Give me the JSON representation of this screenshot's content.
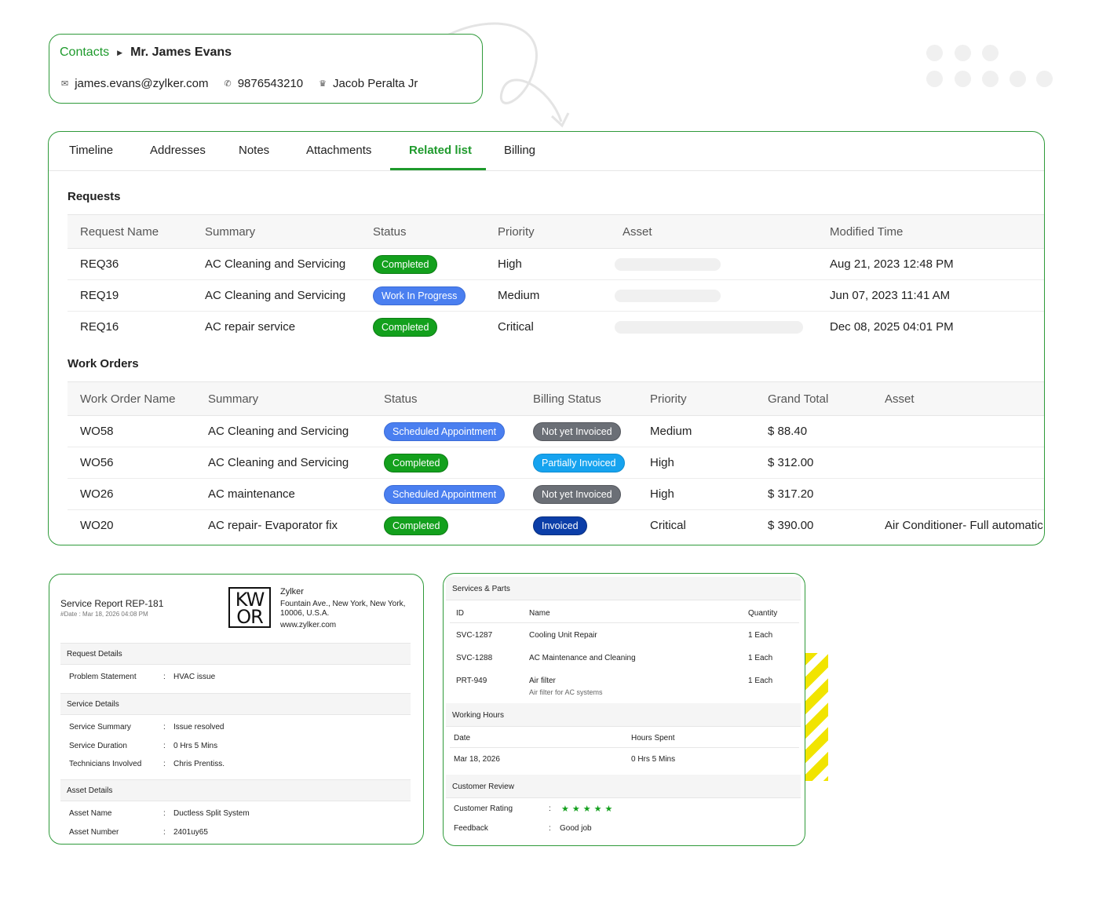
{
  "header": {
    "breadcrumb_link": "Contacts",
    "contact_name": "Mr. James Evans",
    "email": "james.evans@zylker.com",
    "phone": "9876543210",
    "account": "Jacob Peralta Jr"
  },
  "tabs": [
    "Timeline",
    "Addresses",
    "Notes",
    "Attachments",
    "Related list",
    "Billing"
  ],
  "active_tab": "Related list",
  "requests": {
    "title": "Requests",
    "columns": [
      "Request Name",
      "Summary",
      "Status",
      "Priority",
      "Asset",
      "Modified Time"
    ],
    "rows": [
      {
        "name": "REQ36",
        "summary": "AC Cleaning and Servicing",
        "status": "Completed",
        "priority": "High",
        "modified": "Aug 21, 2023 12:48 PM"
      },
      {
        "name": "REQ19",
        "summary": "AC Cleaning and Servicing",
        "status": "Work In Progress",
        "priority": "Medium",
        "modified": "Jun 07, 2023 11:41 AM"
      },
      {
        "name": "REQ16",
        "summary": "AC repair service",
        "status": "Completed",
        "priority": "Critical",
        "modified": "Dec 08, 2025 04:01 PM"
      }
    ]
  },
  "work_orders": {
    "title": "Work Orders",
    "columns": [
      "Work Order Name",
      "Summary",
      "Status",
      "Billing Status",
      "Priority",
      "Grand Total",
      "Asset"
    ],
    "rows": [
      {
        "name": "WO58",
        "summary": "AC Cleaning and Servicing",
        "status": "Scheduled Appointment",
        "billing": "Not yet Invoiced",
        "priority": "Medium",
        "total": "$ 88.40",
        "asset": ""
      },
      {
        "name": "WO56",
        "summary": "AC Cleaning and Servicing",
        "status": "Completed",
        "billing": "Partially Invoiced",
        "priority": "High",
        "total": "$ 312.00",
        "asset": ""
      },
      {
        "name": "WO26",
        "summary": "AC maintenance",
        "status": "Scheduled Appointment",
        "billing": "Not yet Invoiced",
        "priority": "High",
        "total": "$ 317.20",
        "asset": ""
      },
      {
        "name": "WO20",
        "summary": "AC repair- Evaporator fix",
        "status": "Completed",
        "billing": "Invoiced",
        "priority": "Critical",
        "total": "$ 390.00",
        "asset": "Air Conditioner- Full automatic,"
      }
    ]
  },
  "report": {
    "title": "Service Report REP-181",
    "date": "#Date : Mar 18, 2026 04:08 PM",
    "logo_text": "KWOR",
    "company_name": "Zylker",
    "company_address": "Fountain Ave., New York, New York, 10006, U.S.A.",
    "company_web": "www.zylker.com",
    "sections": {
      "request_details": "Request Details",
      "service_details": "Service Details",
      "asset_details": "Asset Details"
    },
    "fields": {
      "problem_statement_label": "Problem Statement",
      "problem_statement": "HVAC issue",
      "service_summary_label": "Service Summary",
      "service_summary": "Issue resolved",
      "service_duration_label": "Service Duration",
      "service_duration": "0 Hrs 5 Mins",
      "technicians_label": "Technicians Involved",
      "technicians": "Chris Prentiss.",
      "asset_name_label": "Asset Name",
      "asset_name": "Ductless Split System",
      "asset_number_label": "Asset Number",
      "asset_number": "2401uy65"
    },
    "colon": ":"
  },
  "services": {
    "title": "Services & Parts",
    "columns": {
      "id": "ID",
      "name": "Name",
      "quantity": "Quantity"
    },
    "rows": [
      {
        "id": "SVC-1287",
        "name": "Cooling Unit Repair",
        "qty": "1 Each",
        "desc": ""
      },
      {
        "id": "SVC-1288",
        "name": "AC Maintenance and Cleaning",
        "qty": "1 Each",
        "desc": ""
      },
      {
        "id": "PRT-949",
        "name": "Air filter",
        "qty": "1 Each",
        "desc": "Air filter for AC systems"
      }
    ],
    "working_hours": {
      "title": "Working Hours",
      "col_date": "Date",
      "col_hours": "Hours Spent",
      "date": "Mar 18, 2026",
      "hours": "0 Hrs 5 Mins"
    },
    "review": {
      "title": "Customer Review",
      "rating_label": "Customer Rating",
      "rating": 5,
      "rating_stars": "★★★★★",
      "feedback_label": "Feedback",
      "feedback": "Good job"
    }
  },
  "colors": {
    "brand_green": "#1e9a2c",
    "badge_completed": "#13a01d",
    "badge_scheduled": "#4a7ff0",
    "badge_not_invoiced": "#6b6f76",
    "badge_partial": "#16a3ef",
    "badge_invoiced": "#0b3ea8"
  },
  "icons": {
    "email": "envelope-icon",
    "phone": "phone-icon",
    "account": "crown-icon"
  }
}
